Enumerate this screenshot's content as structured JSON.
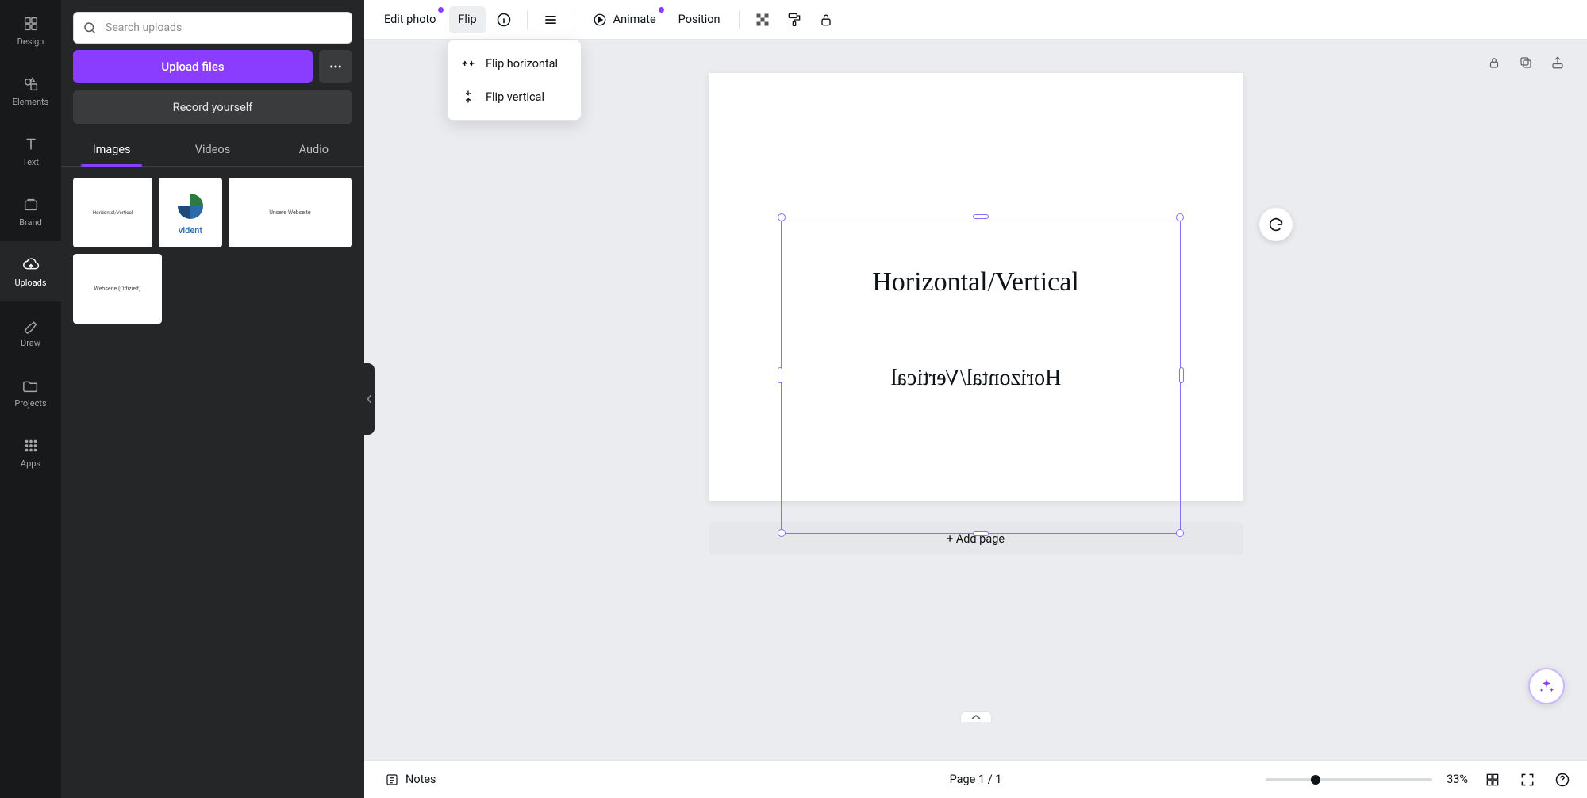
{
  "rail": {
    "design": "Design",
    "elements": "Elements",
    "text": "Text",
    "brand": "Brand",
    "uploads": "Uploads",
    "draw": "Draw",
    "projects": "Projects",
    "apps": "Apps"
  },
  "panel": {
    "search_placeholder": "Search uploads",
    "upload_label": "Upload files",
    "record_label": "Record yourself",
    "tabs": {
      "images": "Images",
      "videos": "Videos",
      "audio": "Audio"
    },
    "thumbs": {
      "t1_caption": "Horizontal/Vertical",
      "t2_caption": "vident",
      "t3_caption": "Unsere Webseite",
      "t4_caption": "Webseite (Offizielt)"
    }
  },
  "toolbar": {
    "edit_photo": "Edit photo",
    "flip": "Flip",
    "animate": "Animate",
    "position": "Position"
  },
  "flip_menu": {
    "horizontal": "Flip horizontal",
    "vertical": "Flip vertical"
  },
  "canvas": {
    "text_normal": "Horizontal/Vertical",
    "text_flipped": "Horizontal/Vertical",
    "add_page": "+ Add page"
  },
  "bottom": {
    "notes": "Notes",
    "page_indicator": "Page 1 / 1",
    "zoom_pct": "33%"
  },
  "colors": {
    "accent": "#8b3dff",
    "selection": "#8b6cff"
  }
}
